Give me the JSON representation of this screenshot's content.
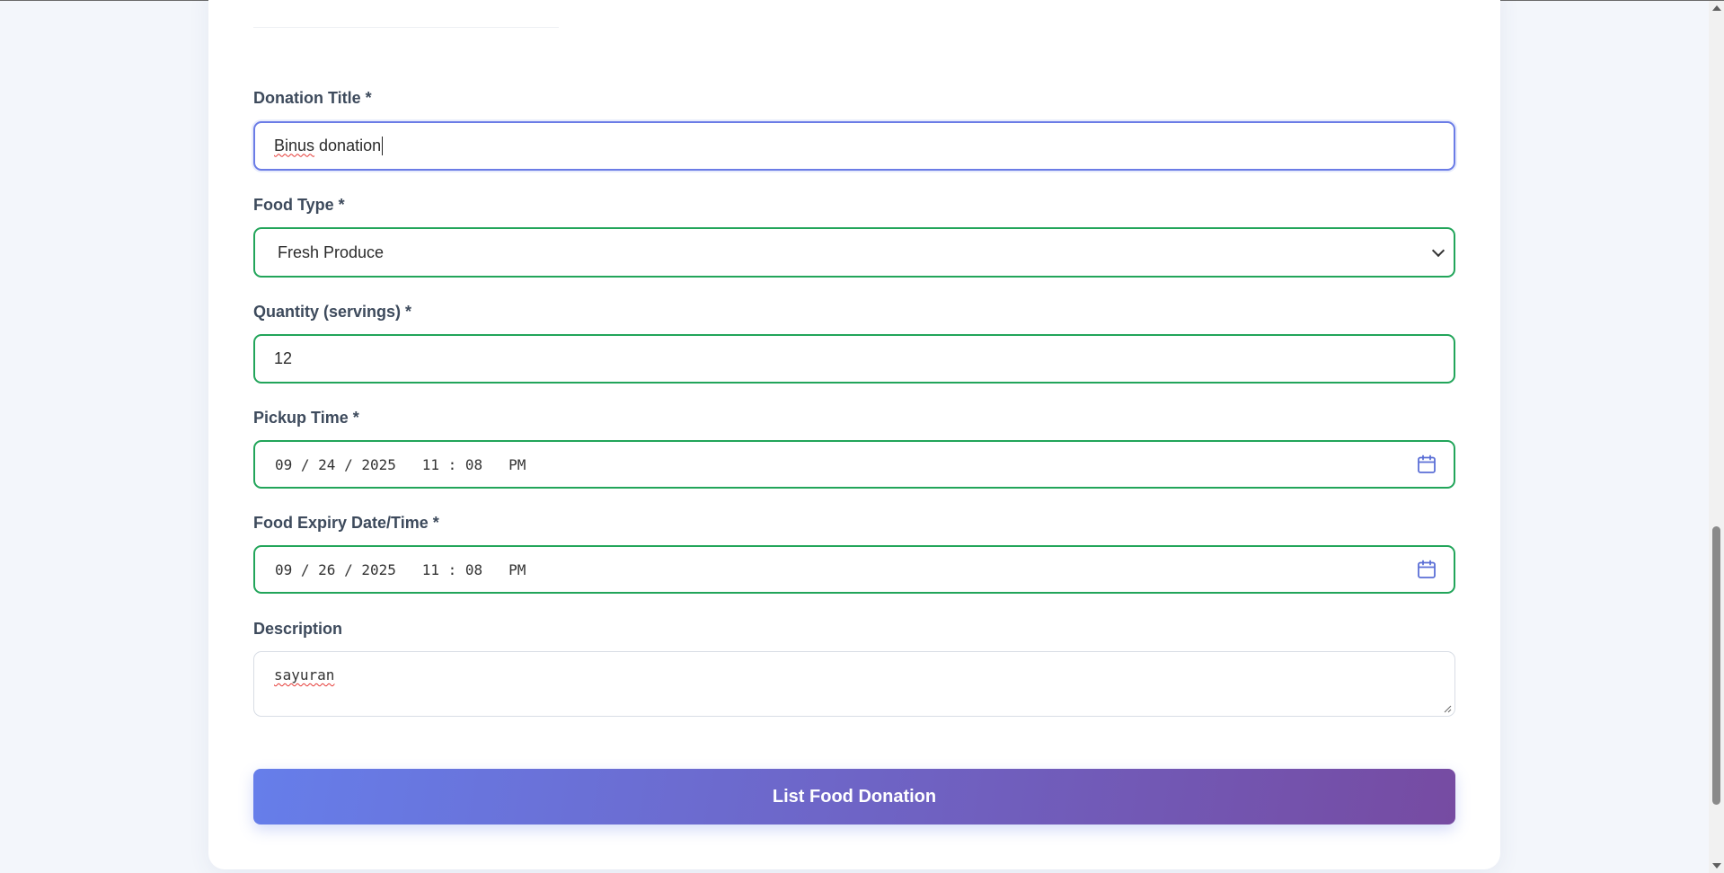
{
  "form": {
    "title_label": "Donation Title *",
    "title_value": "Binus donation",
    "title_value_word1": "Binus",
    "title_value_rest": " donation",
    "food_type_label": "Food Type *",
    "food_type_value": "Fresh Produce",
    "quantity_label": "Quantity (servings) *",
    "quantity_value": "12",
    "pickup_label": "Pickup Time *",
    "pickup_value": "09 / 24 / 2025   11 : 08   PM",
    "expiry_label": "Food Expiry Date/Time *",
    "expiry_value": "09 / 26 / 2025   11 : 08   PM",
    "description_label": "Description",
    "description_value": "sayuran",
    "submit_label": "List Food Donation"
  },
  "colors": {
    "valid_border": "#22a55a",
    "focus_border": "#6b7ce6",
    "gradient_start": "#667eea",
    "gradient_end": "#764ba2",
    "icon_color": "#5b6fd6"
  },
  "icons": {
    "select_chevron": "chevron-down-icon",
    "date_picker": "calendar-icon",
    "textarea_resize": "resize-handle-icon"
  }
}
